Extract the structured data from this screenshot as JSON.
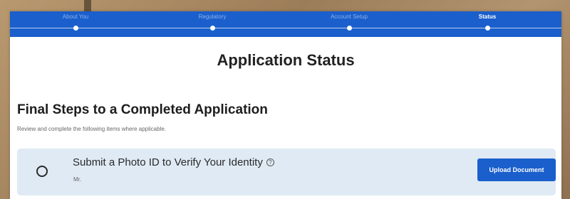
{
  "progress": {
    "steps": [
      {
        "label": "About You",
        "state": "complete"
      },
      {
        "label": "Regulatory",
        "state": "complete"
      },
      {
        "label": "Account Setup",
        "state": "complete"
      },
      {
        "label": "Status",
        "state": "current"
      }
    ]
  },
  "main": {
    "title": "Application Status",
    "section_title": "Final Steps to a Completed Application",
    "section_subtitle": "Review and complete the following items where applicable.",
    "task": {
      "title": "Submit a Photo ID to Verify Your Identity",
      "help_icon": "?",
      "subtitle": "Mr.",
      "button_label": "Upload Document"
    }
  },
  "colors": {
    "primary_blue": "#1a5fcc",
    "card_background": "#dfeaf4"
  }
}
